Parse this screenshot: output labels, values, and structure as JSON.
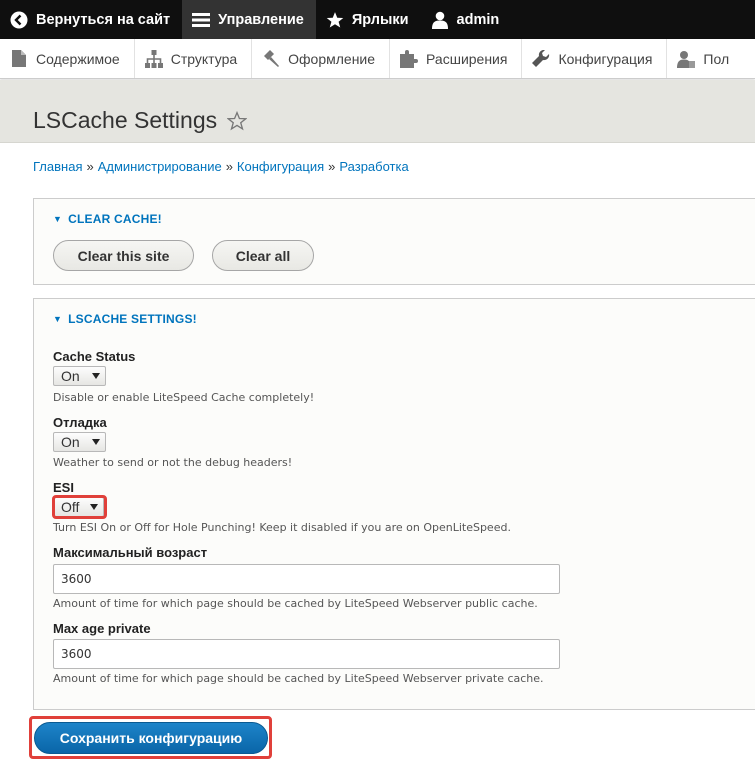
{
  "toolbar": {
    "items": [
      {
        "label": "Вернуться на сайт",
        "icon": "back-icon"
      },
      {
        "label": "Управление",
        "icon": "menu-icon"
      },
      {
        "label": "Ярлыки",
        "icon": "star-icon"
      },
      {
        "label": "admin",
        "icon": "user-icon"
      }
    ]
  },
  "tray": {
    "items": [
      {
        "label": "Содержимое",
        "icon": "content-icon"
      },
      {
        "label": "Структура",
        "icon": "structure-icon"
      },
      {
        "label": "Оформление",
        "icon": "appearance-icon"
      },
      {
        "label": "Расширения",
        "icon": "extend-icon"
      },
      {
        "label": "Конфигурация",
        "icon": "wrench-icon"
      },
      {
        "label": "Пол",
        "icon": "people-icon"
      }
    ]
  },
  "page": {
    "title": "LSCache Settings"
  },
  "breadcrumb": [
    "Главная",
    "Администрирование",
    "Конфигурация",
    "Разработка"
  ],
  "clear_cache": {
    "summary": "CLEAR CACHE!",
    "buttons": [
      "Clear this site",
      "Clear all"
    ]
  },
  "settings": {
    "summary": "LSCACHE SETTINGS!",
    "cache_status": {
      "label": "Cache Status",
      "value": "On",
      "description": "Disable or enable LiteSpeed Cache completely!"
    },
    "debug": {
      "label": "Отладка",
      "value": "On",
      "description": "Weather to send or not the debug headers!"
    },
    "esi": {
      "label": "ESI",
      "value": "Off",
      "description": "Turn ESI On or Off for Hole Punching! Keep it disabled if you are on OpenLiteSpeed."
    },
    "max_age": {
      "label": "Максимальный возраст",
      "value": "3600",
      "description": "Amount of time for which page should be cached by LiteSpeed Webserver public cache."
    },
    "max_age_private": {
      "label": "Max age private",
      "value": "3600",
      "description": "Amount of time for which page should be cached by LiteSpeed Webserver private cache."
    }
  },
  "save_label": "Сохранить конфигурацию",
  "colors": {
    "link": "#0074bd",
    "toolbar_bg": "#0f0f0f",
    "highlight": "#e0403a",
    "primary_button": "#0a66a8"
  }
}
